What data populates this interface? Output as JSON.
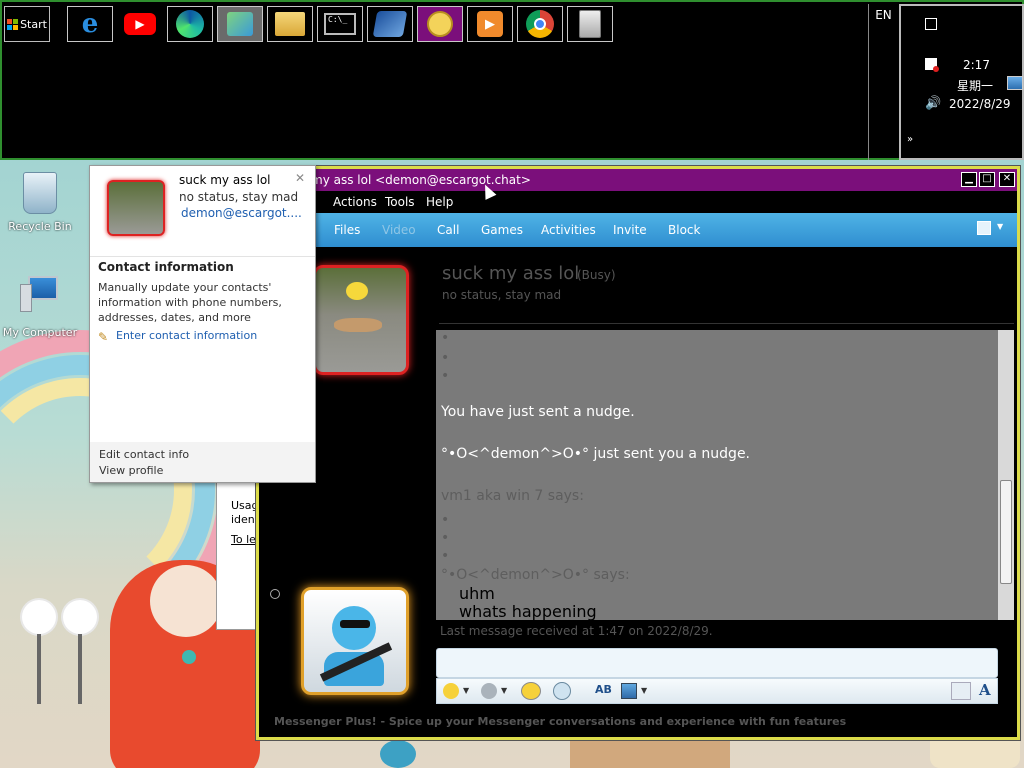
{
  "taskbar": {
    "start_label": "Start",
    "buttons": [
      "ie-icon",
      "youtube-icon",
      "edge-icon",
      "control-panel-icon",
      "file-explorer-icon",
      "cmd-icon",
      "messenger-plus-icon",
      "msn-icon",
      "media-player-icon",
      "chrome-icon",
      "recycle-icon"
    ],
    "language": "EN",
    "clock_time": "2:17",
    "clock_day": "星期一",
    "clock_date": "2022/8/29"
  },
  "desktop": {
    "icons": [
      {
        "label": "Recycle Bin"
      },
      {
        "label": "My Computer"
      }
    ]
  },
  "messenger": {
    "title": "my ass lol <demon@escargot.chat>",
    "menu": [
      "Actions",
      "Tools",
      "Help"
    ],
    "toolbar": [
      "Files",
      "Video",
      "Call",
      "Games",
      "Activities",
      "Invite",
      "Block"
    ],
    "contact_name": "suck my ass lol",
    "contact_status": "(Busy)",
    "contact_message": "no status, stay mad",
    "chat_lines": [
      {
        "text": "•",
        "style": "dim"
      },
      {
        "text": "•",
        "style": "dim"
      },
      {
        "text": "•",
        "style": "dim"
      },
      {
        "text": "You have just sent a nudge.",
        "style": "normal"
      },
      {
        "text": "°•O<^demon^>O•° just sent you a nudge.",
        "style": "normal"
      },
      {
        "text": "vm1 aka win 7 says:",
        "style": "dim"
      },
      {
        "text": "•",
        "style": "dim"
      },
      {
        "text": "•",
        "style": "dim"
      },
      {
        "text": "•",
        "style": "dim"
      },
      {
        "text": "°•O<^demon^>O•° says:",
        "style": "dim"
      },
      {
        "text": "uhm",
        "style": "black"
      },
      {
        "text": "whats happening",
        "style": "black"
      }
    ],
    "last_message": "Last message received at 1:47 on 2022/8/29.",
    "footer": "Messenger Plus! - Spice up your Messenger conversations and experience with fun features",
    "behind_window_text": [
      "Usag",
      "ident",
      "To le"
    ]
  },
  "contact_card": {
    "name": "suck my ass lol",
    "status": "no status, stay mad",
    "email": "demon@escargot....",
    "section_title": "Contact information",
    "section_body": "Manually update your contacts' information with phone numbers, addresses, dates, and more",
    "enter_link": "Enter contact information",
    "edit_link": "Edit contact info",
    "profile_link": "View profile"
  }
}
